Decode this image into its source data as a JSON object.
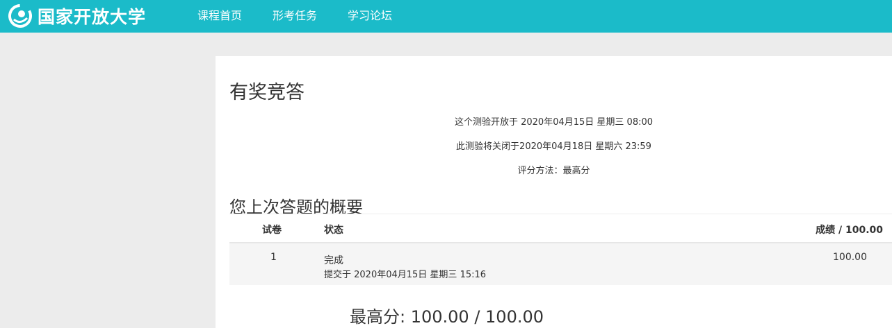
{
  "header": {
    "logo_text": "国家开放大学",
    "nav": [
      "课程首页",
      "形考任务",
      "学习论坛"
    ]
  },
  "quiz": {
    "title": "有奖竞答",
    "open_info": "这个测验开放于 2020年04月15日 星期三 08:00",
    "close_info": "此测验将关闭于2020年04月18日 星期六 23:59",
    "grading_method": "评分方法：最高分"
  },
  "summary": {
    "title": "您上次答题的概要",
    "columns": [
      "试卷",
      "状态",
      "成绩 / 100.00"
    ],
    "rows": [
      {
        "attempt": "1",
        "status": "完成",
        "submitted": "提交于 2020年04月15日 星期三 15:16",
        "grade": "100.00"
      }
    ]
  },
  "highest_grade": "最高分: 100.00 / 100.00",
  "colors": {
    "header": "#1bbbc9",
    "page_bg": "#ececec"
  }
}
